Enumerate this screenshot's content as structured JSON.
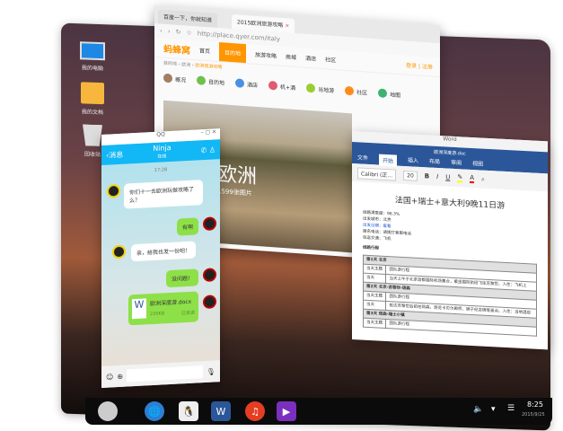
{
  "desktop": {
    "icons": [
      {
        "label": "我的电脑",
        "icon": "laptop-icon"
      },
      {
        "label": "我的文档",
        "icon": "folder-icon"
      },
      {
        "label": "回收站",
        "icon": "recycle-bin-icon"
      }
    ]
  },
  "browser": {
    "tabs": [
      {
        "label": "百度一下，你就知道"
      },
      {
        "label": "2015欧洲旅游攻略"
      }
    ],
    "url": "http://place.qyer.com/italy",
    "site_name": "蚂蜂窝",
    "nav": [
      "首页",
      "目的地",
      "旅游攻略",
      "商城",
      "酒店",
      "社区"
    ],
    "nav_active": "目的地",
    "breadcrumb": [
      "目的地",
      "欧洲",
      "欧洲旅游攻略"
    ],
    "login": "登录",
    "register": "注册",
    "categories": [
      {
        "label": "概况",
        "color": "#a08060"
      },
      {
        "label": "目的地",
        "color": "#6cc24a"
      },
      {
        "label": "酒店",
        "color": "#4a90e2"
      },
      {
        "label": "机+酒",
        "color": "#e05a70"
      },
      {
        "label": "当地游",
        "color": "#9acd32"
      },
      {
        "label": "社区",
        "color": "#ff8c1a"
      },
      {
        "label": "地图",
        "color": "#3cb371"
      }
    ],
    "hero_title": "欧洲",
    "hero_sub": "1599张图片"
  },
  "qq": {
    "title": "QQ",
    "back": "消息",
    "contact": "Ninja",
    "contact_status": "在线",
    "time": "17:28",
    "messages": [
      {
        "dir": "in",
        "text": "你们十一去欧洲玩做攻略了么？"
      },
      {
        "dir": "out",
        "text": "有啊"
      },
      {
        "dir": "in",
        "text": "亲，给我也发一份吧！"
      },
      {
        "dir": "out",
        "text": "没问题！"
      }
    ],
    "file": {
      "name": "欧洲深度游.docx",
      "size": "235KB",
      "status": "已发送"
    }
  },
  "word": {
    "app": "Word",
    "filename": "欧洲深度游.doc",
    "tabs": [
      "文件",
      "开始",
      "插入",
      "布局",
      "审阅",
      "视图"
    ],
    "active_tab": "开始",
    "font": "Calibri (正...",
    "size": "20",
    "title": "法国+瑞士+意大利9晚11日游",
    "info": [
      "线路满意度：96.3%",
      "出发城市：北京",
      "出发日期：查看",
      "报名电话：请拨打客服电话",
      "往返交通：飞机"
    ],
    "section": "线路行程",
    "days": [
      {
        "day": "第1天 北京",
        "theme_label": "当天主题",
        "theme": "团队游行程",
        "desc_label": "当天",
        "desc": "当天上午于北京首都国际机场集合，乘坐国际航班飞往苏黎世。入住：飞机上"
      },
      {
        "day": "第2天 北京-苏黎世-琉森",
        "theme_label": "当天主题",
        "theme": "团队游行程",
        "desc_label": "当天",
        "desc": "抵达苏黎世后前往琉森，游览卡贝尔廊桥、狮子纪念碑等景点。入住：当地酒店"
      },
      {
        "day": "第3天 琉森-瑞士小镇",
        "theme_label": "当天主题",
        "theme": "团队游行程"
      }
    ]
  },
  "taskbar": {
    "apps": [
      "start",
      "browser",
      "qq",
      "word",
      "music",
      "video"
    ],
    "time": "8:25",
    "date": "2015/9/25"
  }
}
